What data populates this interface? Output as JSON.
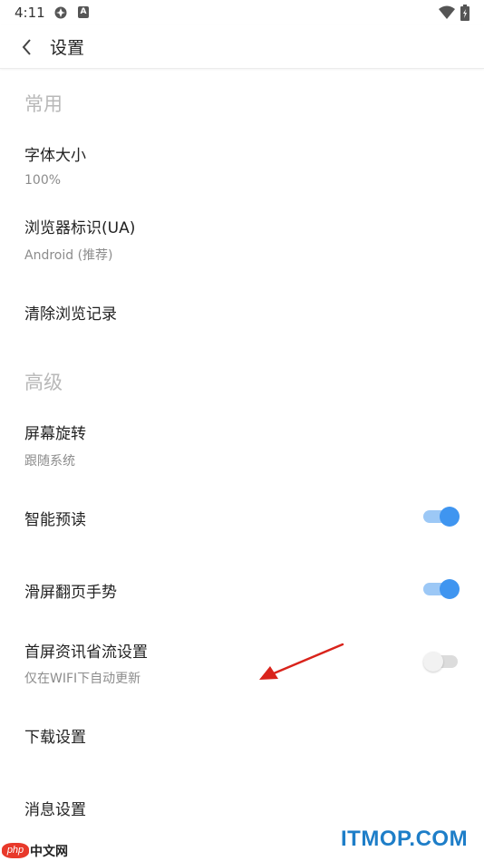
{
  "status_bar": {
    "time": "4:11",
    "icons": [
      "sync-icon",
      "a-icon",
      "wifi-icon",
      "battery-icon"
    ]
  },
  "header": {
    "title": "设置",
    "back_icon": "chevron-left-icon"
  },
  "sections": {
    "common": {
      "title": "常用",
      "font_size": {
        "title": "字体大小",
        "value": "100%"
      },
      "ua": {
        "title": "浏览器标识(UA)",
        "value": "Android (推荐)"
      },
      "clear_history": {
        "title": "清除浏览记录"
      }
    },
    "advanced": {
      "title": "高级",
      "rotation": {
        "title": "屏幕旋转",
        "value": "跟随系统"
      },
      "smart_preload": {
        "title": "智能预读",
        "enabled": true
      },
      "swipe_gesture": {
        "title": "滑屏翻页手势",
        "enabled": true
      },
      "data_saver": {
        "title": "首屏资讯省流设置",
        "subtitle": "仅在WIFI下自动更新",
        "enabled": false
      },
      "download": {
        "title": "下载设置"
      },
      "notifications": {
        "title": "消息设置"
      }
    }
  },
  "colors": {
    "accent": "#3f95f0",
    "annotation_arrow": "#d9231b"
  },
  "watermarks": {
    "right": "ITMOP.COM",
    "left_badge": "php",
    "left_text": "中文网"
  }
}
